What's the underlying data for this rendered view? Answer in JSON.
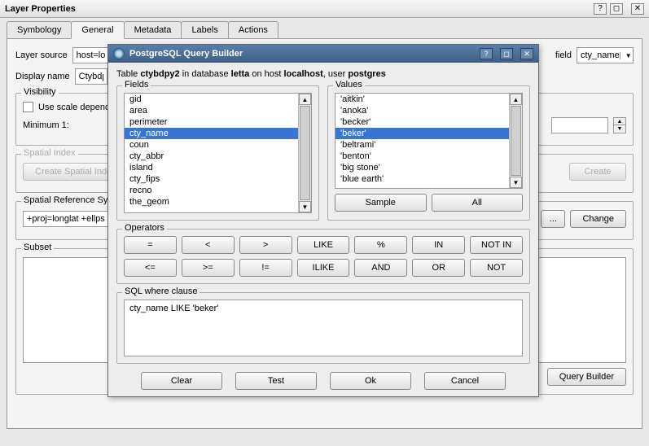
{
  "window": {
    "title": "Layer Properties",
    "help": "?",
    "restore": "◻",
    "close": "✕"
  },
  "tabs": [
    "Symbology",
    "General",
    "Metadata",
    "Labels",
    "Actions"
  ],
  "active_tab": 1,
  "general": {
    "layer_source_label": "Layer source",
    "layer_source_value": "host=lo",
    "display_name_label": "Display name",
    "display_name_value": "Ctybdp",
    "field_label": "field",
    "field_value": "cty_name",
    "visibility": {
      "title": "Visibility",
      "use_scale_label": "Use scale depend",
      "min_label": "Minimum 1:"
    },
    "spatial_index": {
      "title": "Spatial Index",
      "create_btn": "Create Spatial Index",
      "create_right": "Create"
    },
    "srs": {
      "title": "Spatial Reference Sy",
      "value": "+proj=longlat +ellps",
      "change": "Change"
    },
    "subset": {
      "title": "Subset",
      "query_builder": "Query Builder"
    }
  },
  "modal": {
    "title": "PostgreSQL Query Builder",
    "sentence": {
      "a": "Table ",
      "b": "ctybdpy2",
      "c": " in database ",
      "d": "letta",
      "e": " on host ",
      "f": "localhost",
      "g": ", user ",
      "h": "postgres"
    },
    "fields_label": "Fields",
    "values_label": "Values",
    "fields": [
      "gid",
      "area",
      "perimeter",
      "cty_name",
      "coun",
      "cty_abbr",
      "island",
      "cty_fips",
      "recno",
      "the_geom"
    ],
    "fields_sel": 3,
    "values": [
      "'aitkin'",
      "'anoka'",
      "'becker'",
      "'beker'",
      "'beltrami'",
      "'benton'",
      "'big stone'",
      "'blue earth'"
    ],
    "values_sel": 3,
    "sample": "Sample",
    "all": "All",
    "operators_label": "Operators",
    "ops": [
      "=",
      "<",
      ">",
      "LIKE",
      "%",
      "IN",
      "NOT IN",
      "<=",
      ">=",
      "!=",
      "ILIKE",
      "AND",
      "OR",
      "NOT"
    ],
    "sql_label": "SQL where clause",
    "sql_value": "cty_name LIKE 'beker'",
    "buttons": [
      "Clear",
      "Test",
      "Ok",
      "Cancel"
    ]
  }
}
